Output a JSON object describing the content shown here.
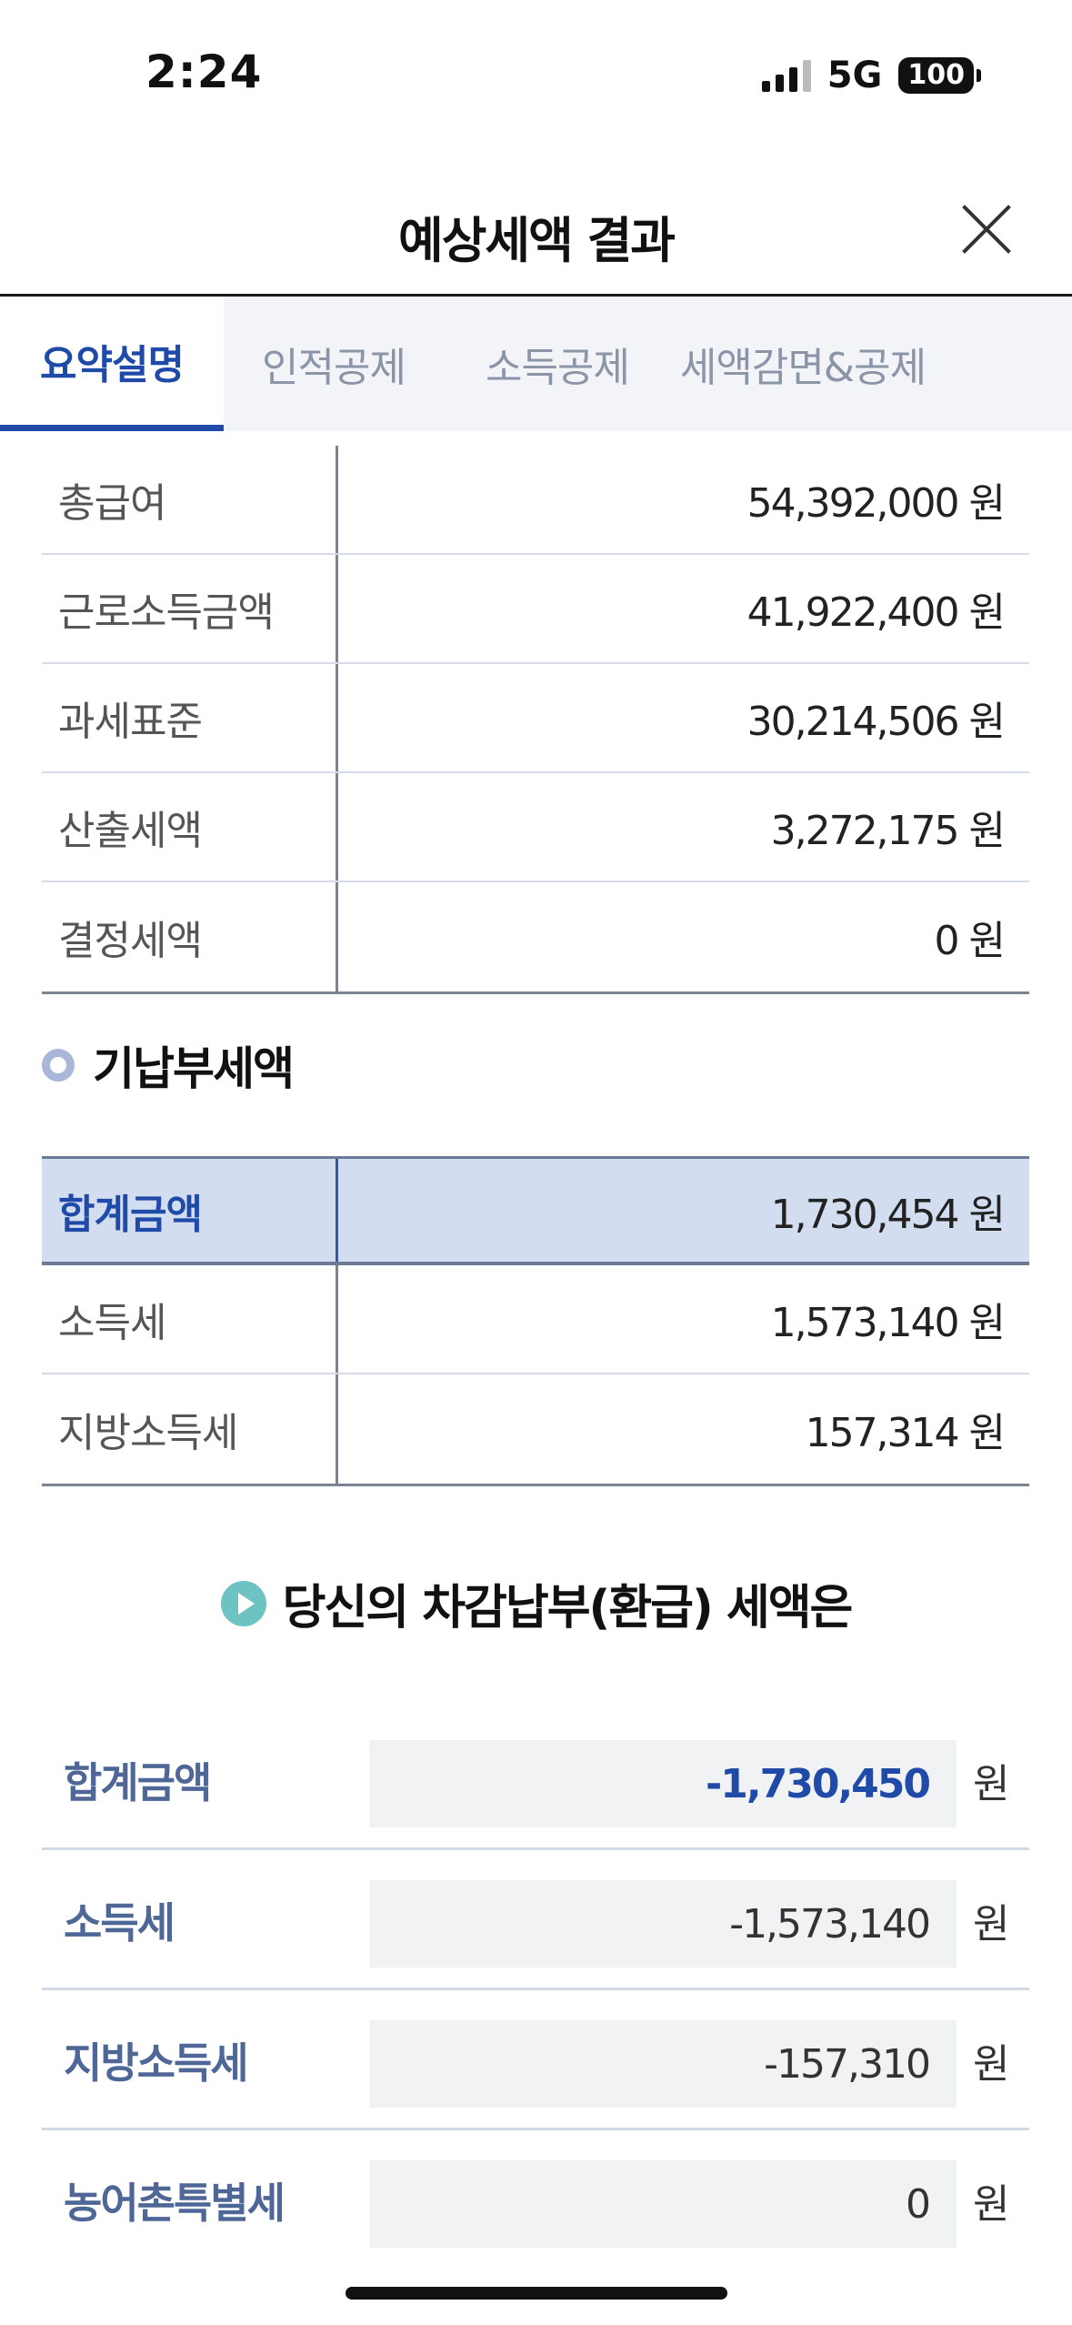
{
  "status_bar": {
    "time": "2:24",
    "network": "5G",
    "battery": "100"
  },
  "header": {
    "title": "예상세액 결과"
  },
  "tabs": [
    {
      "label": "요약설명",
      "active": true
    },
    {
      "label": "인적공제",
      "active": false
    },
    {
      "label": "소득공제",
      "active": false
    },
    {
      "label": "세액감면&공제",
      "active": false
    }
  ],
  "summary": {
    "rows": [
      {
        "label": "총급여",
        "value": "54,392,000 원"
      },
      {
        "label": "근로소득금액",
        "value": "41,922,400 원"
      },
      {
        "label": "과세표준",
        "value": "30,214,506 원"
      },
      {
        "label": "산출세액",
        "value": "3,272,175 원"
      },
      {
        "label": "결정세액",
        "value": "0 원"
      }
    ]
  },
  "prepaid": {
    "title": "기납부세액",
    "rows": [
      {
        "label": "합계금액",
        "value": "1,730,454 원"
      },
      {
        "label": "소득세",
        "value": "1,573,140 원"
      },
      {
        "label": "지방소득세",
        "value": "157,314 원"
      }
    ]
  },
  "result": {
    "title": "당신의 차감납부(환급) 세액은",
    "unit": "원",
    "rows": [
      {
        "label": "합계금액",
        "value": "-1,730,450"
      },
      {
        "label": "소득세",
        "value": "-1,573,140"
      },
      {
        "label": "지방소득세",
        "value": "-157,310"
      },
      {
        "label": "농어촌특별세",
        "value": "0"
      }
    ]
  },
  "colors": {
    "accent": "#1f4aa8",
    "highlight_row": "#d2ddf0",
    "result_icon": "#6cc3c2"
  }
}
